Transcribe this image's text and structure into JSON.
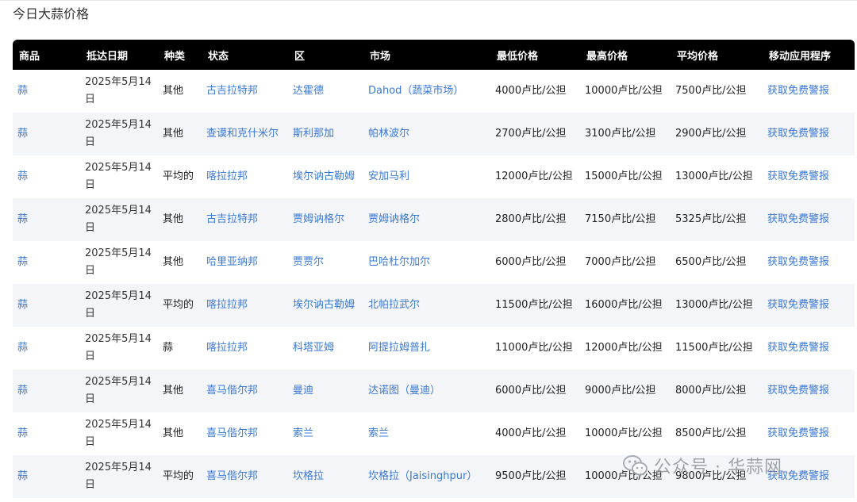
{
  "page": {
    "title": "今日大蒜价格"
  },
  "table": {
    "headers": [
      "商品",
      "抵达日期",
      "种类",
      "状态",
      "区",
      "市场",
      "最低价格",
      "最高价格",
      "平均价格",
      "移动应用程序"
    ],
    "rows": [
      {
        "commodity": "蒜",
        "date": "2025年5月14日",
        "variety": "其他",
        "state": "古吉拉特邦",
        "district": "达霍德",
        "market": "Dahod（蔬菜市场）",
        "min": "4000卢比/公担",
        "max": "10000卢比/公担",
        "avg": "7500卢比/公担",
        "app": "获取免费警报"
      },
      {
        "commodity": "蒜",
        "date": "2025年5月14日",
        "variety": "其他",
        "state": "查谟和克什米尔",
        "district": "斯利那加",
        "market": "帕林波尔",
        "min": "2700卢比/公担",
        "max": "3100卢比/公担",
        "avg": "2900卢比/公担",
        "app": "获取免费警报"
      },
      {
        "commodity": "蒜",
        "date": "2025年5月14日",
        "variety": "平均的",
        "state": "喀拉拉邦",
        "district": "埃尔讷古勒姆",
        "market": "安加马利",
        "min": "12000卢比/公担",
        "max": "15000卢比/公担",
        "avg": "13000卢比/公担",
        "app": "获取免费警报"
      },
      {
        "commodity": "蒜",
        "date": "2025年5月14日",
        "variety": "其他",
        "state": "古吉拉特邦",
        "district": "贾姆讷格尔",
        "market": "贾姆讷格尔",
        "min": "2800卢比/公担",
        "max": "7150卢比/公担",
        "avg": "5325卢比/公担",
        "app": "获取免费警报"
      },
      {
        "commodity": "蒜",
        "date": "2025年5月14日",
        "variety": "其他",
        "state": "哈里亚纳邦",
        "district": "贾贾尔",
        "market": "巴哈杜尔加尔",
        "min": "6000卢比/公担",
        "max": "7000卢比/公担",
        "avg": "6500卢比/公担",
        "app": "获取免费警报"
      },
      {
        "commodity": "蒜",
        "date": "2025年5月14日",
        "variety": "平均的",
        "state": "喀拉拉邦",
        "district": "埃尔讷古勒姆",
        "market": "北帕拉武尔",
        "min": "11500卢比/公担",
        "max": "16000卢比/公担",
        "avg": "13000卢比/公担",
        "app": "获取免费警报"
      },
      {
        "commodity": "蒜",
        "date": "2025年5月14日",
        "variety": "蒜",
        "state": "喀拉拉邦",
        "district": "科塔亚姆",
        "market": "阿提拉姆普扎",
        "min": "11000卢比/公担",
        "max": "12000卢比/公担",
        "avg": "11500卢比/公担",
        "app": "获取免费警报"
      },
      {
        "commodity": "蒜",
        "date": "2025年5月14日",
        "variety": "其他",
        "state": "喜马偕尔邦",
        "district": "曼迪",
        "market": "达诺图（曼迪）",
        "min": "6000卢比/公担",
        "max": "9000卢比/公担",
        "avg": "8000卢比/公担",
        "app": "获取免费警报"
      },
      {
        "commodity": "蒜",
        "date": "2025年5月14日",
        "variety": "其他",
        "state": "喜马偕尔邦",
        "district": "索兰",
        "market": "索兰",
        "min": "4000卢比/公担",
        "max": "10000卢比/公担",
        "avg": "8500卢比/公担",
        "app": "获取免费警报"
      },
      {
        "commodity": "蒜",
        "date": "2025年5月14日",
        "variety": "平均的",
        "state": "喜马偕尔邦",
        "district": "坎格拉",
        "market": "坎格拉（Jaisinghpur）",
        "min": "9500卢比/公担",
        "max": "10000卢比/公担",
        "avg": "9800卢比/公担",
        "app": "获取免费警报"
      }
    ]
  },
  "watermark": {
    "text": "公众号 · 华蒜网",
    "icon": "wechat-icon"
  },
  "colors": {
    "header_bg": "#000000",
    "link": "#3a78d6",
    "stripe": "#f4f5f8"
  }
}
